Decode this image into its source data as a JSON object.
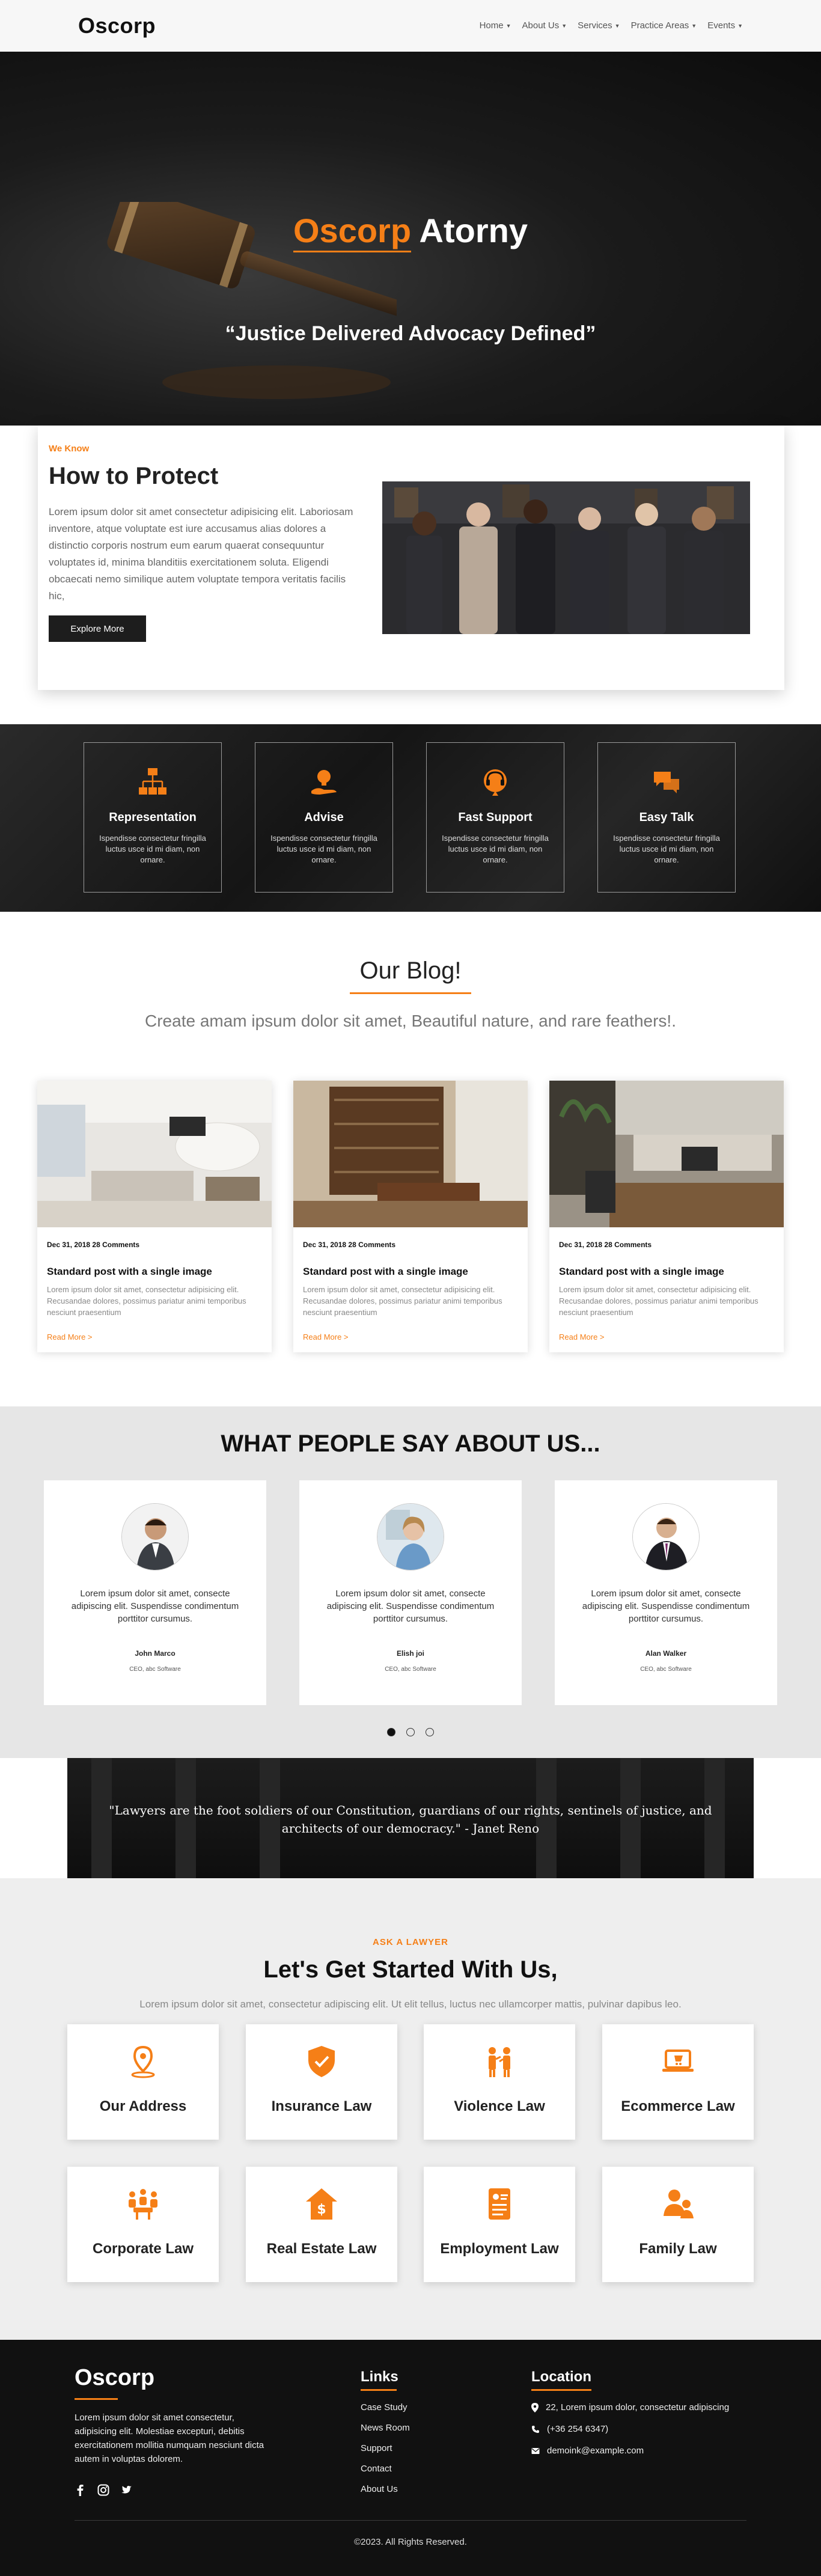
{
  "nav": {
    "brand": "Oscorp",
    "items": [
      {
        "label": "Home"
      },
      {
        "label": "About Us"
      },
      {
        "label": "Services"
      },
      {
        "label": "Practice Areas"
      },
      {
        "label": "Events"
      }
    ]
  },
  "hero": {
    "title_accent": "Oscorp",
    "title_rest": "Atorny",
    "subtitle": "“Justice Delivered Advocacy Defined”"
  },
  "about": {
    "eyebrow": "We Know",
    "title": "How to Protect",
    "text": "Lorem ipsum dolor sit amet consectetur adipisicing elit. Laboriosam inventore, atque voluptate est iure accusamus alias dolores a distinctio corporis nostrum eum earum quaerat consequuntur voluptates id, minima blanditiis exercitationem soluta. Eligendi obcaecati nemo similique autem voluptate tempora veritatis facilis hic,",
    "button": "Explore More"
  },
  "services": [
    {
      "title": "Representation",
      "text": "Ispendisse consectetur fringilla luctus usce id mi diam, non ornare.",
      "icon": "hierarchy-icon"
    },
    {
      "title": "Advise",
      "text": "Ispendisse consectetur fringilla luctus usce id mi diam, non ornare.",
      "icon": "idea-hand-icon"
    },
    {
      "title": "Fast Support",
      "text": "Ispendisse consectetur fringilla luctus usce id mi diam, non ornare.",
      "icon": "headset-icon"
    },
    {
      "title": "Easy Talk",
      "text": "Ispendisse consectetur fringilla luctus usce id mi diam, non ornare.",
      "icon": "chat-icon"
    }
  ],
  "blog": {
    "title": "Our Blog!",
    "subtitle": "Create amam ipsum dolor sit amet, Beautiful nature, and rare feathers!.",
    "posts": [
      {
        "meta": "Dec 31, 2018 28 Comments",
        "title": "Standard post with a single image",
        "excerpt": "Lorem ipsum dolor sit amet, consectetur adipisicing elit. Recusandae dolores, possimus pariatur animi temporibus nesciunt praesentium",
        "read_more": "Read More >"
      },
      {
        "meta": "Dec 31, 2018 28 Comments",
        "title": "Standard post with a single image",
        "excerpt": "Lorem ipsum dolor sit amet, consectetur adipisicing elit. Recusandae dolores, possimus pariatur animi temporibus nesciunt praesentium",
        "read_more": "Read More >"
      },
      {
        "meta": "Dec 31, 2018 28 Comments",
        "title": "Standard post with a single image",
        "excerpt": "Lorem ipsum dolor sit amet, consectetur adipisicing elit. Recusandae dolores, possimus pariatur animi temporibus nesciunt praesentium",
        "read_more": "Read More >"
      }
    ]
  },
  "testimonials": {
    "heading": "WHAT PEOPLE SAY ABOUT US...",
    "items": [
      {
        "quote": "Lorem ipsum dolor sit amet, consecte adipiscing elit. Suspendisse condimentum porttitor cursumus.",
        "name": "John Marco",
        "role": "CEO, abc Software"
      },
      {
        "quote": "Lorem ipsum dolor sit amet, consecte adipiscing elit. Suspendisse condimentum porttitor cursumus.",
        "name": "Elish joi",
        "role": "CEO, abc Software"
      },
      {
        "quote": "Lorem ipsum dolor sit amet, consecte adipiscing elit. Suspendisse condimentum porttitor cursumus.",
        "name": "Alan Walker",
        "role": "CEO, abc Software"
      }
    ],
    "active_dot": 1,
    "dot_count": 3
  },
  "quote_banner": {
    "text": "\"Lawyers are the foot soldiers of our Constitution, guardians of our rights, sentinels of justice, and architects of our democracy.\" - Janet Reno"
  },
  "practice": {
    "eyebrow": "ASK A LAWYER",
    "title": "Let's Get Started With Us,",
    "subtitle": "Lorem ipsum dolor sit amet, consectetur adipiscing elit. Ut elit tellus, luctus nec ullamcorper mattis, pulvinar dapibus leo.",
    "areas": [
      {
        "label": "Our Address",
        "icon": "location-pin-icon"
      },
      {
        "label": "Insurance Law",
        "icon": "shield-check-icon"
      },
      {
        "label": "Violence Law",
        "icon": "people-fight-icon"
      },
      {
        "label": "Ecommerce Law",
        "icon": "laptop-cart-icon"
      },
      {
        "label": "Corporate Law",
        "icon": "meeting-icon"
      },
      {
        "label": "Real Estate Law",
        "icon": "house-dollar-icon"
      },
      {
        "label": "Employment Law",
        "icon": "resume-icon"
      },
      {
        "label": "Family Law",
        "icon": "family-icon"
      }
    ]
  },
  "footer": {
    "brand": "Oscorp",
    "about": "Lorem ipsum dolor sit amet consectetur, adipisicing elit. Molestiae excepturi, debitis exercitationem mollitia numquam nesciunt dicta autem in voluptas dolorem.",
    "links_title": "Links",
    "links": [
      "Case Study",
      "News Room",
      "Support",
      "Contact",
      "About Us"
    ],
    "location_title": "Location",
    "address": "22, Lorem ipsum dolor, consectetur adipiscing",
    "phone": "(+36 254 6347)",
    "email": "demoink@example.com",
    "copyright": "©2023. All Rights Reserved."
  },
  "colors": {
    "accent": "#f57f17",
    "dark": "#111111"
  }
}
